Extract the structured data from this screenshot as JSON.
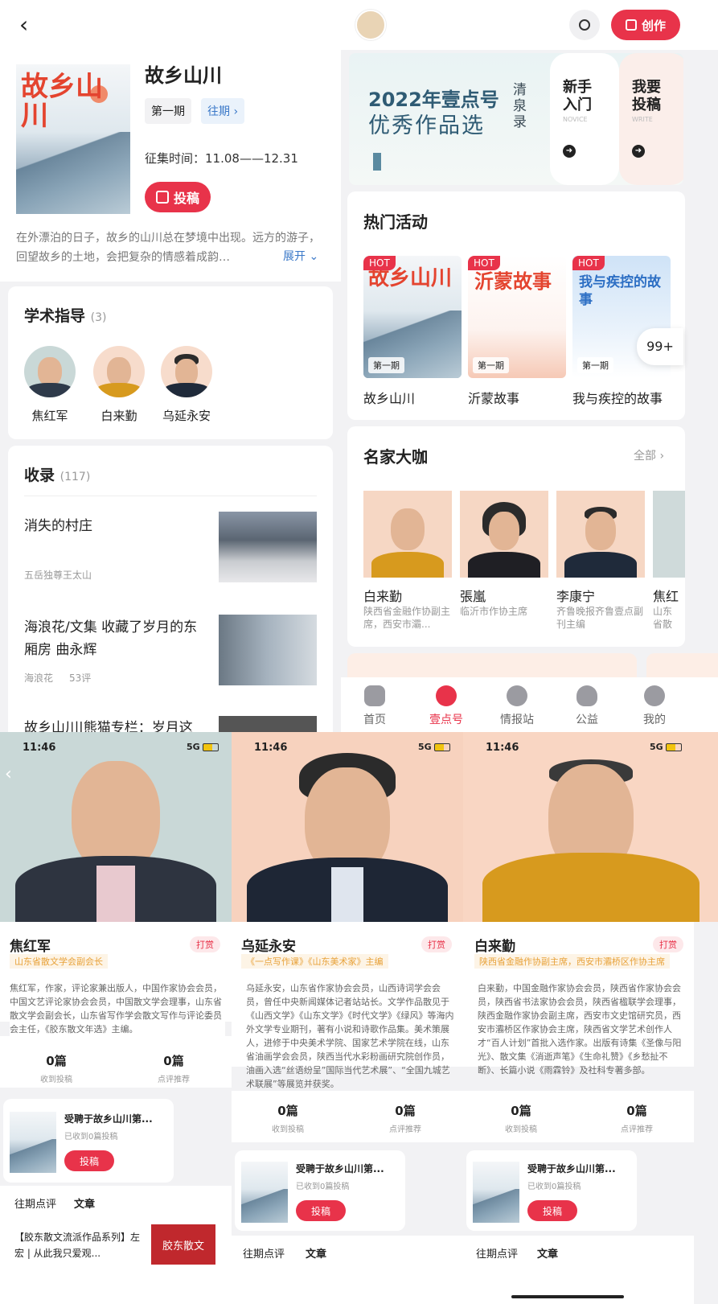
{
  "left_top": {
    "title": "故乡山川",
    "period": "第一期",
    "past_period": "往期",
    "collect_time": "征集时间：11.08——12.31",
    "submit_btn": "投稿",
    "description": "在外漂泊的日子，故乡的山川总在梦境中出现。远方的游子，回望故乡的土地，会把复杂的情感着成韵…",
    "expand": "展开",
    "cover_text": "故乡山川"
  },
  "academic": {
    "title": "学术指导",
    "count": "(3)",
    "mentors": [
      {
        "name": "焦红军"
      },
      {
        "name": "白来勤"
      },
      {
        "name": "乌延永安"
      }
    ]
  },
  "collection": {
    "title": "收录",
    "count": "(117)",
    "items": [
      {
        "title": "消失的村庄",
        "author": "五岳独尊王太山",
        "comments": ""
      },
      {
        "title": "海浪花/文集  收藏了岁月的东厢房  曲永辉",
        "author": "海浪花",
        "comments": "53评"
      },
      {
        "title": "故乡山川|熊猫专栏：岁月这",
        "author": "",
        "comments": ""
      }
    ]
  },
  "right_header": {
    "create_btn": "创作"
  },
  "banner": {
    "main_line1": "2022年壹点号",
    "main_line2": "优秀作品选",
    "side_text": "清泉录",
    "card1_line1": "新手",
    "card1_line2": "入门",
    "card1_sub": "NOVICE",
    "card2_line1": "我要",
    "card2_line2": "投稿",
    "card2_sub": "WRITE"
  },
  "hot": {
    "title": "热门活动",
    "badge": "99+",
    "hot_tag": "HOT",
    "items": [
      {
        "name": "故乡山川",
        "period": "第一期",
        "cover": "故乡山川"
      },
      {
        "name": "沂蒙故事",
        "period": "第一期",
        "cover": "沂蒙故事"
      },
      {
        "name": "我与疾控的故事",
        "period": "第一期",
        "cover": "我与疾控的故事"
      }
    ]
  },
  "masters": {
    "title": "名家大咖",
    "all": "全部",
    "items": [
      {
        "name": "白来勤",
        "desc": "陕西省金融作协副主席，西安市灞..."
      },
      {
        "name": "張嵐",
        "desc": "临沂市作协主席"
      },
      {
        "name": "李康宁",
        "desc": "齐鲁晚报齐鲁壹点副刊主编"
      },
      {
        "name": "焦红",
        "desc": "山东省散文学会会长"
      }
    ]
  },
  "tabbar": {
    "items": [
      {
        "label": "首页"
      },
      {
        "label": "壹点号"
      },
      {
        "label": "情报站"
      },
      {
        "label": "公益"
      },
      {
        "label": "我的"
      }
    ]
  },
  "status_bar": {
    "time": "11:46",
    "network": "5G"
  },
  "profiles": [
    {
      "name": "焦红军",
      "reward": "打赏",
      "role": "山东省散文学会副会长",
      "bio": "焦红军，作家，评论家兼出版人，中国作家协会会员，中国文艺评论家协会会员，中国散文学会理事，山东省散文学会副会长，山东省写作学会散文写作与评论委员会主任，《胶东散文年选》主编。",
      "stat1_num": "0篇",
      "stat1_lbl": "收到投稿",
      "stat2_num": "0篇",
      "stat2_lbl": "点评推荐",
      "invite_title": "受聘于故乡山川第...",
      "invite_sub": "已收到0篇投稿",
      "invite_btn": "投稿",
      "tab1": "往期点评",
      "tab2": "文章",
      "article": "【胶东散文流派作品系列】左宏 | 从此我只爱观...",
      "article_thumb": "胶东散文"
    },
    {
      "name": "乌延永安",
      "reward": "打赏",
      "role": "《一点写作课》《山东美术家》主编",
      "bio": "乌延永安，山东省作家协会会员，山西诗词学会会员，曾任中央新闻媒体记者站站长。文学作品散见于《山西文学》《山东文学》《时代文学》《绿风》等海内外文学专业期刊，著有小说和诗歌作品集。美术策展人，进修于中央美术学院、国家艺术学院在线，山东省油画学会会员，陕西当代水彩粉画研究院创作员，油画入选“丝语纷呈”国际当代艺术展”、“全国九城艺术联展”等展览并获奖。",
      "stat1_num": "0篇",
      "stat1_lbl": "收到投稿",
      "stat2_num": "0篇",
      "stat2_lbl": "点评推荐",
      "invite_title": "受聘于故乡山川第...",
      "invite_sub": "已收到0篇投稿",
      "invite_btn": "投稿",
      "tab1": "往期点评",
      "tab2": "文章"
    },
    {
      "name": "白来勤",
      "reward": "打赏",
      "role": "陕西省金融作协副主席，西安市灞桥区作协主席",
      "bio": "白来勤，中国金融作家协会会员，陕西省作家协会会员，陕西省书法家协会会员，陕西省楹联学会理事，陕西金融作家协会副主席，西安市文史馆研究员，西安市灞桥区作家协会主席，陕西省文学艺术创作人才“百人计划”首批入选作家。出版有诗集《圣像与阳光》、散文集《消逝声笔》《生命礼赞》《乡愁扯不断》、长篇小说《雨霖铃》及社科专著多部。",
      "stat1_num": "0篇",
      "stat1_lbl": "收到投稿",
      "stat2_num": "0篇",
      "stat2_lbl": "点评推荐",
      "invite_title": "受聘于故乡山川第...",
      "invite_sub": "已收到0篇投稿",
      "invite_btn": "投稿",
      "tab1": "往期点评",
      "tab2": "文章"
    }
  ],
  "colors": {
    "accent": "#e8334a",
    "role_text": "#e8a23a"
  }
}
